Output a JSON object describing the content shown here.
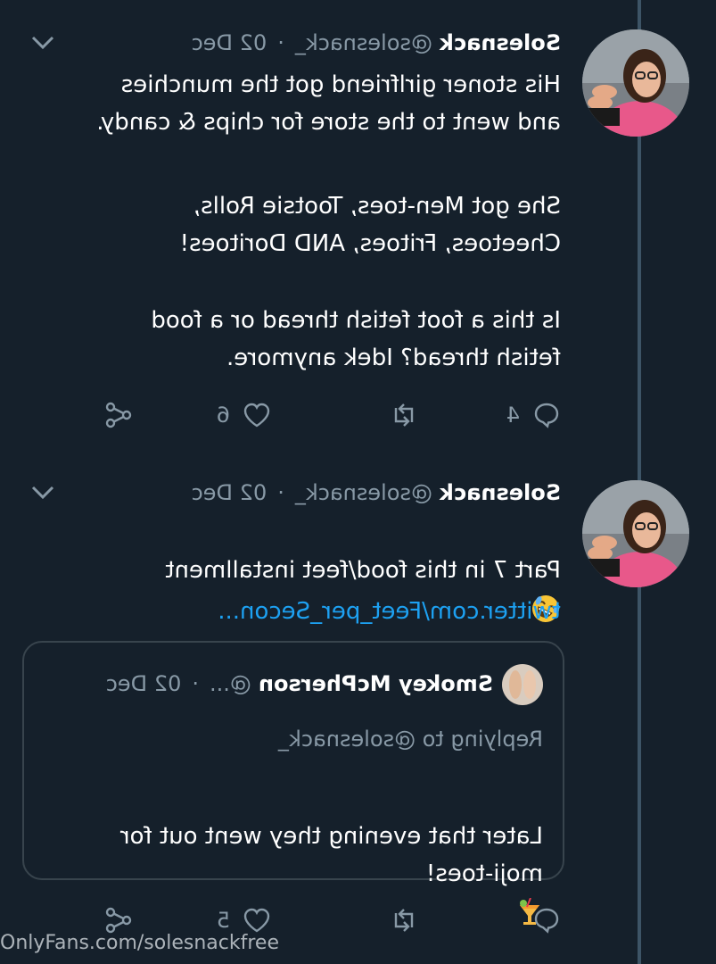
{
  "colors": {
    "background": "#15202b",
    "secondary_text": "#8899a6",
    "link": "#1da1f2",
    "thread_line": "#3d5466",
    "card_border": "#38444d"
  },
  "tweet1": {
    "display_name": "Solesnack",
    "handle": "@solesnack_",
    "separator": "·",
    "date": "02 Dec",
    "paragraphs": [
      "His stoner girlfriend got the munchies\nand went to the store for chips & candy.",
      "She got Men-toes, Tootsie Rolls,\nCheetoes, Fritoes, AND Doritoes!",
      "Is this a foot fetish thread or a food\nfetish thread? Idek anymore."
    ],
    "actions": {
      "reply_count": "4",
      "retweet_count": "",
      "like_count": "6"
    },
    "icons": [
      "chevron-down-icon",
      "reply-icon",
      "retweet-icon",
      "heart-icon",
      "share-icon"
    ]
  },
  "tweet2": {
    "display_name": "Solesnack",
    "handle": "@solesnack_",
    "separator": "·",
    "date": "02 Dec",
    "text": "Part 7 in this food/feet installment",
    "emoji": "rolling-on-floor-laughing",
    "link_text": "twitter.com/Feet_per_Secon...",
    "quoted": {
      "display_name": "Smokey McPherson",
      "handle": "@...",
      "separator": "·",
      "date": "02 Dec",
      "replying_to": "Replying to @solesnack_",
      "text": "Later that evening they went out for\nmoji-toes!",
      "emoji": "tropical-drink"
    },
    "actions": {
      "reply_count": "",
      "retweet_count": "",
      "like_count": "5"
    }
  },
  "watermark": "OnlyFans.com/solesnackfree"
}
